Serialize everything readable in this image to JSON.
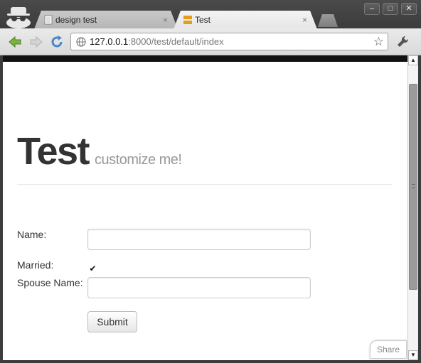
{
  "browser": {
    "tabs": [
      {
        "label": "design test",
        "active": false,
        "close": "×"
      },
      {
        "label": "Test",
        "active": true,
        "close": "×"
      }
    ],
    "window_buttons": {
      "minimize": "–",
      "maximize": "□",
      "close": "✕"
    },
    "address": {
      "host": "127.0.0.1",
      "rest": ":8000/test/default/index"
    },
    "star": "☆"
  },
  "page": {
    "title": "Test",
    "subtitle": "customize me!",
    "form": {
      "name_label": "Name:",
      "name_value": "",
      "married_label": "Married:",
      "married_checked": true,
      "spouse_label": "Spouse Name:",
      "spouse_value": "",
      "submit_label": "Submit"
    },
    "share_label": "Share"
  },
  "colors": {
    "heading": "#333333",
    "subtitle": "#999999",
    "chrome_dark": "#3c3c3c"
  }
}
